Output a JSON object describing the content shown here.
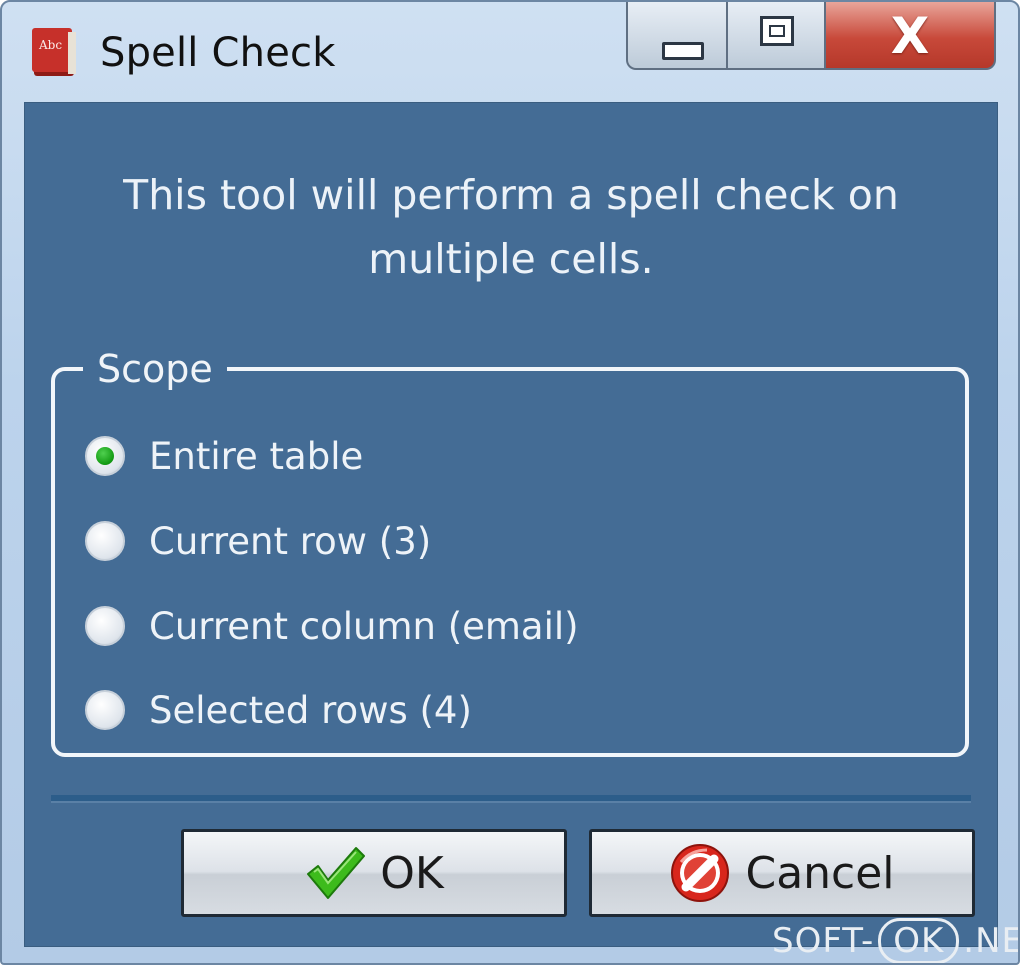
{
  "window": {
    "title": "Spell Check",
    "icon": "book-abc-icon",
    "icon_text": "Abc",
    "controls": {
      "minimize": "minimize-icon",
      "maximize": "maximize-icon",
      "close_glyph": "X"
    }
  },
  "intro": {
    "line1": "This tool will perform a spell check on",
    "line2": "multiple cells."
  },
  "scope": {
    "legend": "Scope",
    "options": [
      {
        "label": "Entire table",
        "checked": true
      },
      {
        "label": "Current row (3)",
        "checked": false
      },
      {
        "label": "Current column (email)",
        "checked": false
      },
      {
        "label": "Selected rows (4)",
        "checked": false
      }
    ]
  },
  "buttons": {
    "ok": {
      "label": "OK",
      "icon": "checkmark-icon"
    },
    "cancel": {
      "label": "Cancel",
      "icon": "no-entry-icon"
    }
  },
  "watermark": {
    "part1": "SOFT-",
    "part2": "OK",
    "part3": ".NET"
  },
  "colors": {
    "panel": "#446c95",
    "radio_checked": "#129a12",
    "ok_check": "#3dbb1c",
    "cancel_red": "#d8261c"
  }
}
